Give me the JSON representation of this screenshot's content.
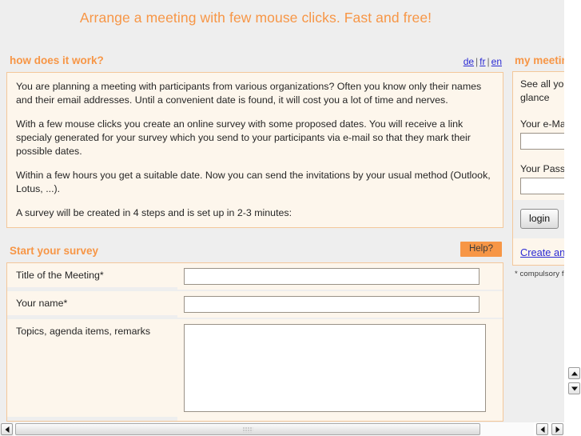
{
  "banner": {
    "headline": "Arrange a meeting with few mouse clicks. Fast and free!"
  },
  "how_it_works": {
    "title": "how does it work?",
    "paragraphs": [
      "You are planning a meeting with participants from various organizations? Often you know only their names and their email addresses. Until a convenient date is found, it will cost you a lot of time and nerves.",
      "With a few mouse clicks you create an online survey with some proposed dates. You will receive a link specialy generated for your survey which you send to your participants via e-mail so that they mark their possible dates.",
      "Within a few hours you get a suitable date. Now you can send the invitations by your usual method (Outlook, Lotus, ...).",
      "A survey will be created in 4 steps and is set up in 2-3 minutes:"
    ]
  },
  "languages": {
    "de": "de",
    "fr": "fr",
    "en": "en",
    "separator": "|"
  },
  "survey": {
    "title": "Start your survey",
    "help_label": "Help?",
    "fields": [
      {
        "label": "Title of the Meeting*",
        "value": "",
        "placeholder": "",
        "type": "text"
      },
      {
        "label": "Your name*",
        "value": "",
        "placeholder": "",
        "type": "text"
      },
      {
        "label": "Topics, agenda items, remarks",
        "value": "",
        "placeholder": "",
        "type": "textarea"
      }
    ]
  },
  "sidebar": {
    "title": "my meetings",
    "intro": "See all your meetings at a glance",
    "email_label": "Your e-Mail",
    "email_value": "",
    "password_label": "Your Password",
    "password_value": "",
    "login_label": "login",
    "create_account_label": "Create an account",
    "compulsory_note": "* compulsory fields"
  },
  "colors": {
    "accent_orange": "#f79646",
    "link_blue": "#2b2bd4",
    "panel_bg": "#fdf6ec",
    "panel_border": "#f3c79a",
    "page_bg": "#eeeeee"
  },
  "scrollbars": {
    "vertical_icon_up": "triangle-up-icon",
    "vertical_icon_down": "triangle-down-icon",
    "horizontal_icon_left": "triangle-left-icon",
    "horizontal_icon_right": "triangle-right-icon"
  }
}
